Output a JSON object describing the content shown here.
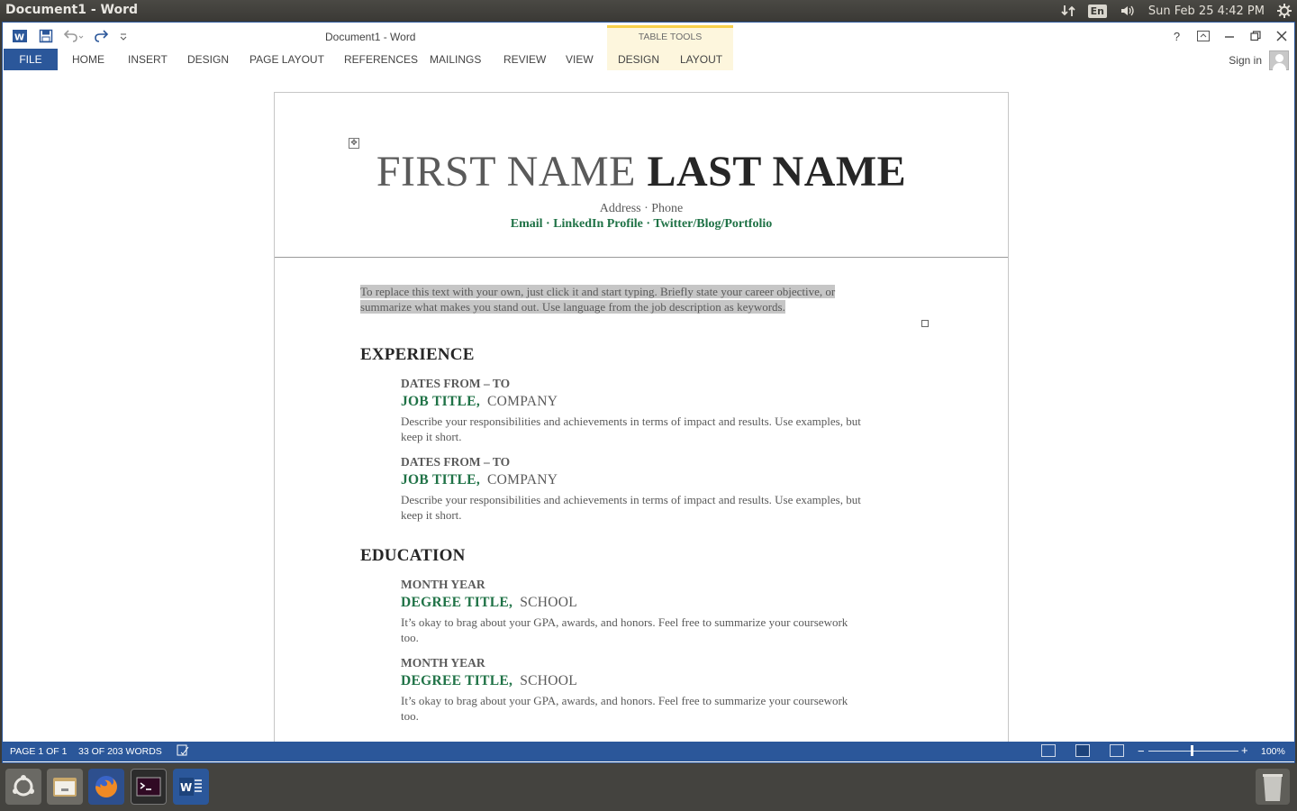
{
  "top_panel": {
    "window_title": "Document1 - Word",
    "language": "En",
    "datetime": "Sun Feb 25  4:42 PM"
  },
  "word": {
    "doc_title": "Document1 - Word",
    "context_group": "TABLE TOOLS",
    "tabs": [
      "FILE",
      "HOME",
      "INSERT",
      "DESIGN",
      "PAGE LAYOUT",
      "REFERENCES",
      "MAILINGS",
      "REVIEW",
      "VIEW",
      "DESIGN",
      "LAYOUT"
    ],
    "sign_in": "Sign in",
    "accent_color": "#2b579a"
  },
  "resume": {
    "first_name": "FIRST NAME",
    "last_name": "LAST NAME",
    "address_line": "Address · Phone",
    "links_line": "Email ·  LinkedIn Profile · Twitter/Blog/Portfolio",
    "objective_1": "To replace this text with your own, just click  it and start typing.  Briefly  state your career objective, or",
    "objective_2": "summarize  what makes you stand out. Use language from the job description  as keywords.",
    "experience": {
      "heading": "EXPERIENCE",
      "entries": [
        {
          "dates": "DATES FROM – TO",
          "title": "JOB TITLE,",
          "org": "COMPANY",
          "desc_1": "Describe your responsibilities  and achievements in terms of impact and results.  Use examples, but",
          "desc_2": "keep it  short."
        },
        {
          "dates": "DATES FROM – TO",
          "title": "JOB TITLE,",
          "org": "COMPANY",
          "desc_1": "Describe your responsibilities  and achievements in terms of impact and results.  Use examples, but",
          "desc_2": "keep it  short."
        }
      ]
    },
    "education": {
      "heading": "EDUCATION",
      "entries": [
        {
          "dates": "MONTH YEAR",
          "title": "DEGREE  TITLE,",
          "org": "SCHOOL",
          "desc_1": "It’s okay to brag about your GPA, awards, and honors.  Feel free to summarize  your coursework",
          "desc_2": "too."
        },
        {
          "dates": "MONTH YEAR",
          "title": "DEGREE  TITLE,",
          "org": "SCHOOL",
          "desc_1": "It’s okay to brag about your GPA, awards, and honors.  Feel free to summarize  your coursework",
          "desc_2": "too."
        }
      ]
    }
  },
  "status": {
    "page": "PAGE 1 OF 1",
    "words": "33 OF 203 WORDS",
    "zoom": "100%",
    "zoom_minus": "−",
    "zoom_plus": "+"
  },
  "dock": {
    "items": [
      "ubuntu-dash-icon",
      "files-icon",
      "firefox-icon",
      "terminal-icon",
      "word-icon",
      "trash-icon"
    ]
  }
}
